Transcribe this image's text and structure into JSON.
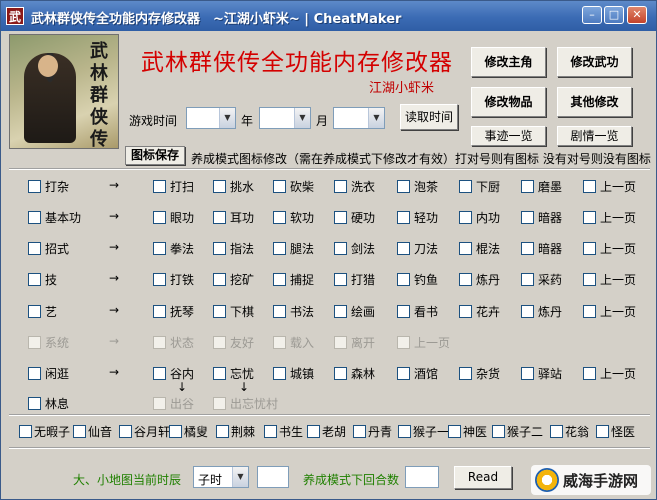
{
  "window": {
    "icon_char": "武",
    "title": "武林群侠传全功能内存修改器　~江湖小虾米~ | CheatMaker",
    "min_glyph": "–",
    "max_glyph": "□",
    "close_glyph": "✕"
  },
  "portrait": {
    "vertical_text": "武林群侠传"
  },
  "header": {
    "title": "武林群侠传全功能内存修改器",
    "subtitle": "江湖小虾米"
  },
  "right_buttons": [
    {
      "label": "修改主角"
    },
    {
      "label": "修改武功"
    },
    {
      "label": "修改物品"
    },
    {
      "label": "其他修改"
    },
    {
      "label": "事迹一览"
    },
    {
      "label": "剧情一览"
    }
  ],
  "game_time": {
    "label": "游戏时间",
    "year_label": "年",
    "month_label": "月",
    "read_button": "读取时间"
  },
  "icon_save": {
    "label": "图标保存",
    "note": "养成模式图标修改（需在养成模式下修改才有效）打对号则有图标 没有对号则没有图标"
  },
  "arrow": "→",
  "rows": [
    {
      "head": "打杂",
      "items": [
        "打扫",
        "挑水",
        "砍柴",
        "洗衣",
        "泡茶",
        "下厨",
        "磨墨",
        "上一页"
      ]
    },
    {
      "head": "基本功",
      "items": [
        "眼功",
        "耳功",
        "软功",
        "硬功",
        "轻功",
        "内功",
        "暗器",
        "上一页"
      ]
    },
    {
      "head": "招式",
      "items": [
        "拳法",
        "指法",
        "腿法",
        "剑法",
        "刀法",
        "棍法",
        "暗器",
        "上一页"
      ]
    },
    {
      "head": "技",
      "items": [
        "打铁",
        "挖矿",
        "捕捉",
        "打猎",
        "钓鱼",
        "炼丹",
        "采药",
        "上一页"
      ]
    },
    {
      "head": "艺",
      "items": [
        "抚琴",
        "下棋",
        "书法",
        "绘画",
        "看书",
        "花卉",
        "炼丹",
        "上一页"
      ]
    },
    {
      "head": "系统",
      "items": [
        "状态",
        "友好",
        "载入",
        "离开",
        "上一页"
      ]
    },
    {
      "head": "闲逛",
      "items": [
        "谷内",
        "忘忧",
        "城镇",
        "森林",
        "酒馆",
        "杂货",
        "驿站",
        "上一页"
      ]
    },
    {
      "head": "林息",
      "items": [
        "出谷",
        "出忘忧村"
      ]
    }
  ],
  "down_arrow": "↓",
  "bottom_checks": [
    "无暇子",
    "仙音",
    "谷月轩",
    "橘叟",
    "荆棘",
    "书生",
    "老胡",
    "丹青",
    "猴子一",
    "神医",
    "猴子二",
    "花翁",
    "怪医"
  ],
  "bottom": {
    "map_label": "大、小地图当前时辰",
    "time_value": "子时",
    "rounds_label": "养成模式下回合数",
    "read_button": "Read",
    "watermark": "威海手游网"
  }
}
